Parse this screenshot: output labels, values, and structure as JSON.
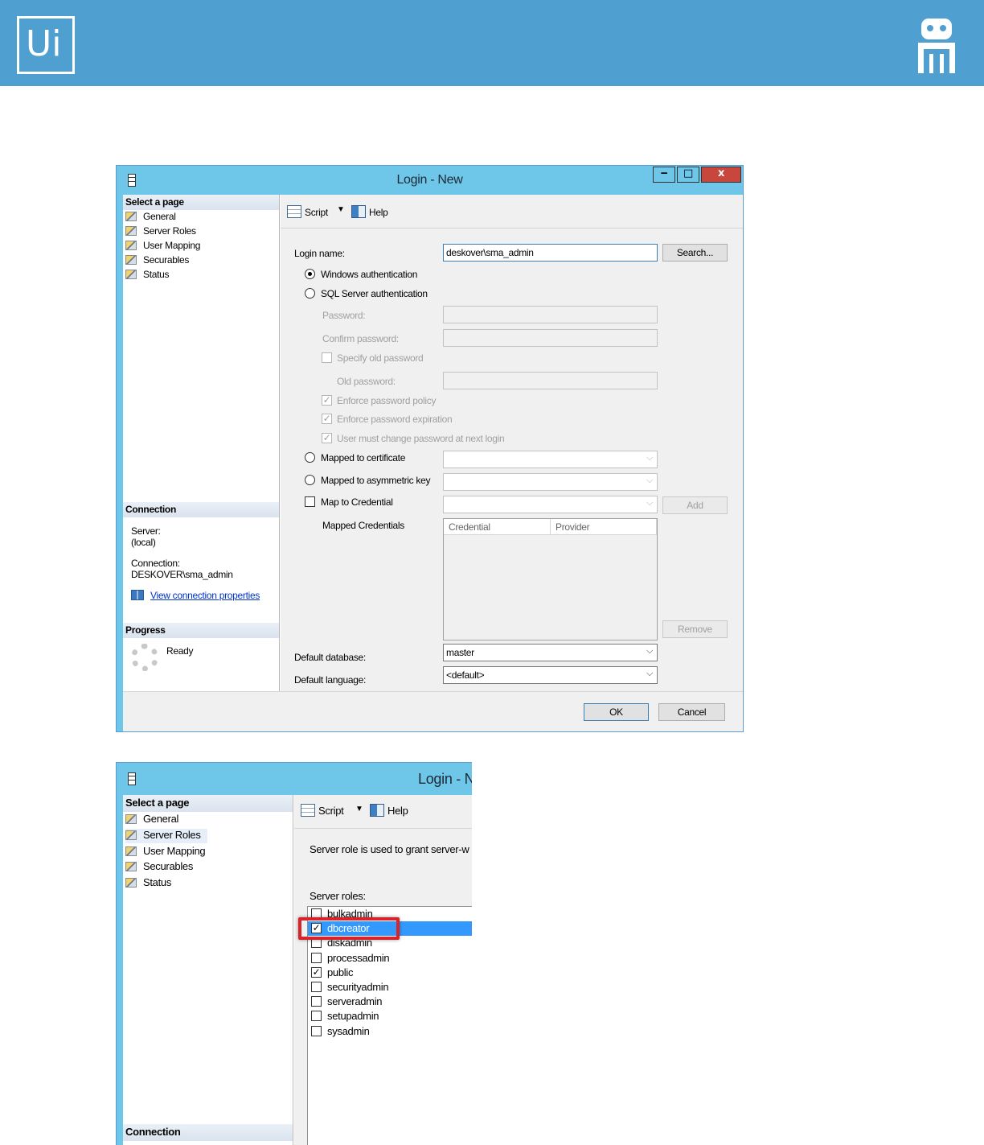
{
  "banner": {
    "logo_text": "Ui"
  },
  "window1": {
    "title": "Login - New",
    "controls": {
      "minimize": "‒",
      "maximize": "□",
      "close": "x"
    },
    "left": {
      "select_page_header": "Select a page",
      "pages": [
        "General",
        "Server Roles",
        "User Mapping",
        "Securables",
        "Status"
      ],
      "connection_header": "Connection",
      "server_label": "Server:",
      "server_value": "(local)",
      "connection_label": "Connection:",
      "connection_value": "DESKOVER\\sma_admin",
      "view_connection_link": "View connection properties",
      "progress_header": "Progress",
      "progress_status": "Ready"
    },
    "toolbar": {
      "script_label": "Script",
      "help_label": "Help"
    },
    "form": {
      "login_name_label": "Login name:",
      "login_name_value": "deskover\\sma_admin",
      "search_button": "Search...",
      "windows_auth_label": "Windows authentication",
      "sql_auth_label": "SQL Server authentication",
      "password_label": "Password:",
      "confirm_password_label": "Confirm password:",
      "specify_old_password_label": "Specify old password",
      "old_password_label": "Old password:",
      "enforce_policy_label": "Enforce password policy",
      "enforce_expiration_label": "Enforce password expiration",
      "must_change_label": "User must change password at next login",
      "mapped_cert_label": "Mapped to certificate",
      "mapped_asym_label": "Mapped to asymmetric key",
      "map_credential_label": "Map to Credential",
      "add_button": "Add",
      "mapped_credentials_label": "Mapped Credentials",
      "grid_columns": [
        "Credential",
        "Provider"
      ],
      "remove_button": "Remove",
      "default_db_label": "Default database:",
      "default_db_value": "master",
      "default_lang_label": "Default language:",
      "default_lang_value": "<default>"
    },
    "footer": {
      "ok_button": "OK",
      "cancel_button": "Cancel"
    }
  },
  "window2": {
    "title": "Login - N",
    "left": {
      "select_page_header": "Select a page",
      "pages": [
        "General",
        "Server Roles",
        "User Mapping",
        "Securables",
        "Status"
      ],
      "connection_header": "Connection"
    },
    "toolbar": {
      "script_label": "Script",
      "help_label": "Help"
    },
    "description": "Server role is used to grant server-w",
    "roles_label": "Server roles:",
    "roles": [
      {
        "name": "bulkadmin",
        "checked": false
      },
      {
        "name": "dbcreator",
        "checked": true
      },
      {
        "name": "diskadmin",
        "checked": false
      },
      {
        "name": "processadmin",
        "checked": false
      },
      {
        "name": "public",
        "checked": true
      },
      {
        "name": "securityadmin",
        "checked": false
      },
      {
        "name": "serveradmin",
        "checked": false
      },
      {
        "name": "setupadmin",
        "checked": false
      },
      {
        "name": "sysadmin",
        "checked": false
      }
    ]
  }
}
